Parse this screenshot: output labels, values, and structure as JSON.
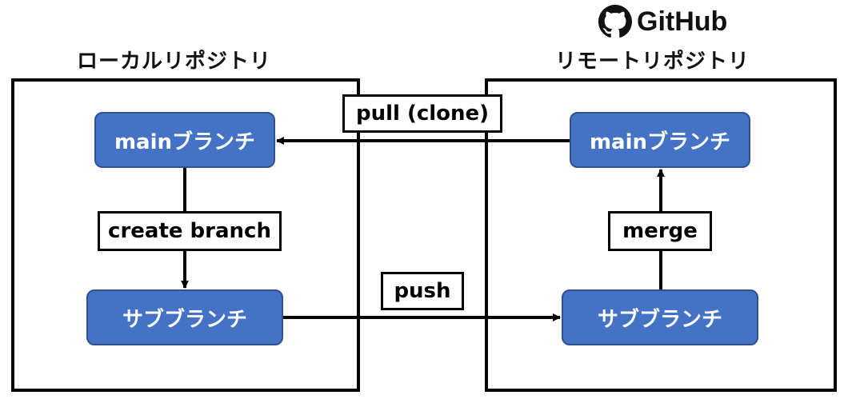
{
  "github": {
    "logo_text": "GitHub",
    "icon": "github-octocat-icon"
  },
  "local": {
    "title": "ローカルリポジトリ",
    "main_branch": "mainブランチ",
    "sub_branch": "サブブランチ"
  },
  "remote": {
    "title": "リモートリポジトリ",
    "main_branch": "mainブランチ",
    "sub_branch": "サブブランチ"
  },
  "labels": {
    "pull": "pull (clone)",
    "create_branch": "create branch",
    "push": "push",
    "merge": "merge"
  },
  "colors": {
    "branch_fill": "#4472c4",
    "branch_border": "#2f528f",
    "line": "#000000"
  }
}
